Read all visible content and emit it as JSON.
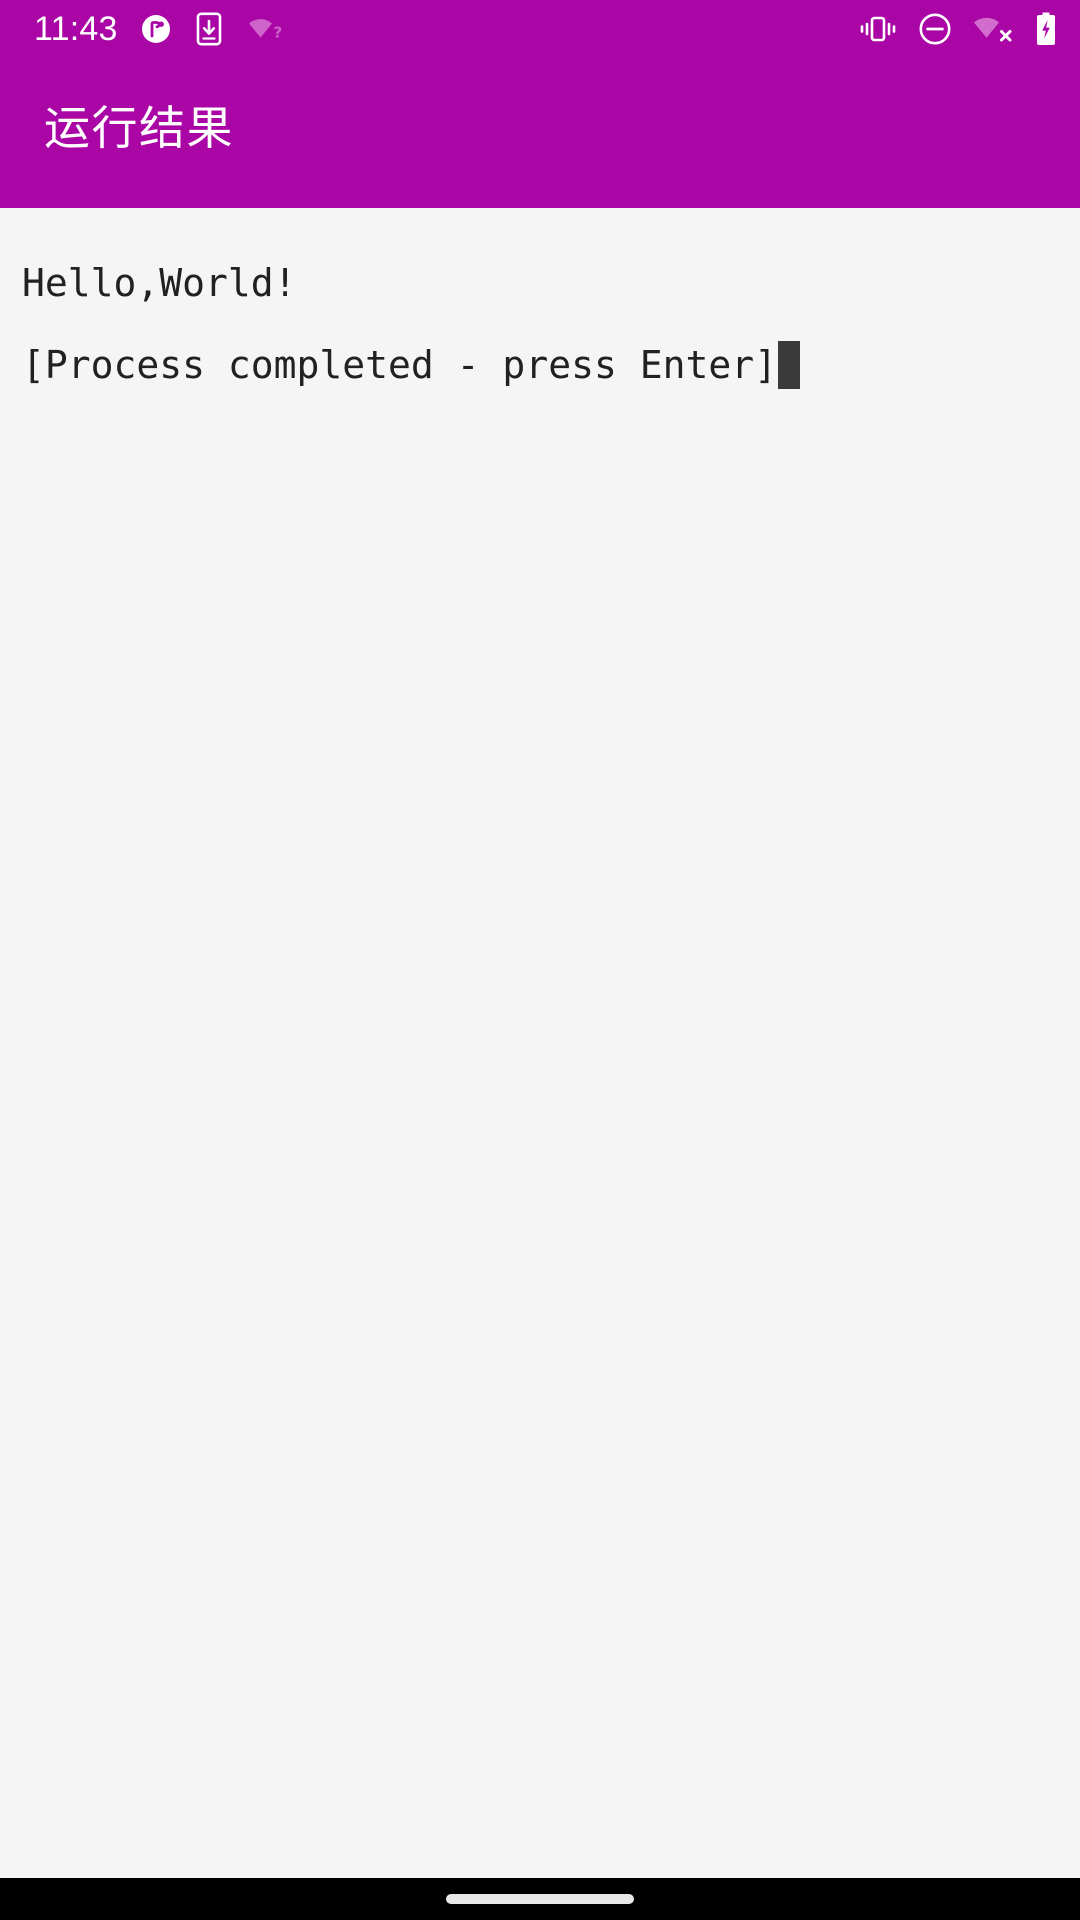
{
  "theme": {
    "accent": "#AA06A6",
    "app_bar_bg": "#AA06A6",
    "status_bar_bg": "#AA06A6",
    "console_bg": "#F5F5F5",
    "console_text": "#212121",
    "cursor_color": "#3A3A3A",
    "nav_bar_bg": "#000000",
    "nav_pill": "#E8E8E8",
    "status_icon_color": "#FFFFFF"
  },
  "status_bar": {
    "clock": "11:43",
    "left_icons": [
      {
        "name": "app-notification-icon",
        "label": "notification"
      },
      {
        "name": "phone-download-icon",
        "label": "download to device"
      },
      {
        "name": "wifi-unknown-icon",
        "label": "wifi unknown"
      }
    ],
    "right_icons": [
      {
        "name": "vibrate-icon",
        "label": "vibrate"
      },
      {
        "name": "do-not-disturb-icon",
        "label": "do not disturb"
      },
      {
        "name": "wifi-off-icon",
        "label": "wifi disconnected"
      },
      {
        "name": "battery-charging-icon",
        "label": "battery charging"
      }
    ]
  },
  "app_bar": {
    "title": "运行结果"
  },
  "console": {
    "lines": [
      "Hello,World!",
      "[Process completed - press Enter]"
    ],
    "cursor_visible": true
  },
  "nav_bar": {
    "gesture_pill": "home-gesture-pill"
  }
}
